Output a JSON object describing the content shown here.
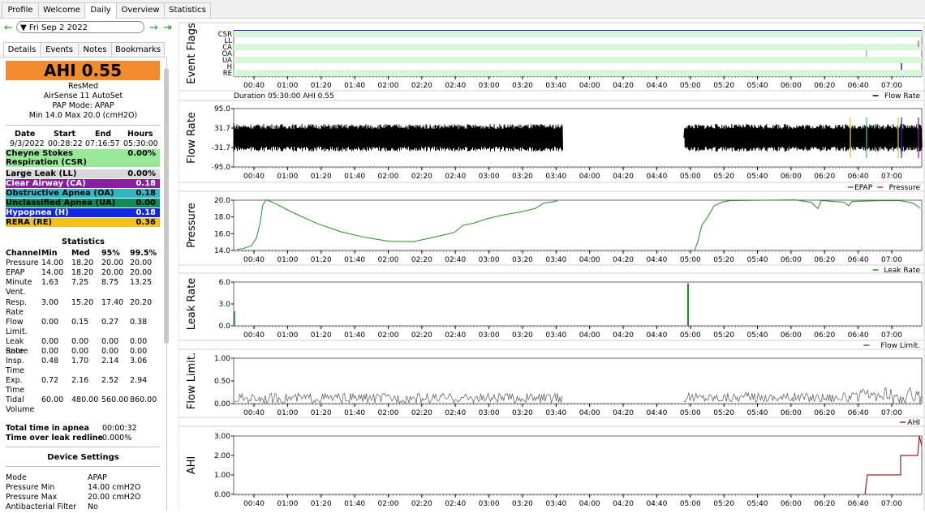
{
  "top_tabs": [
    "Profile",
    "Welcome",
    "Daily",
    "Overview",
    "Statistics"
  ],
  "date": "Fri Sep 2 2022",
  "sub_tabs": [
    "Details",
    "Events",
    "Notes",
    "Bookmarks"
  ],
  "ahi_label": "AHI 0.55",
  "device": {
    "brand": "ResMed",
    "model": "AirSense 11 AutoSet",
    "mode": "PAP Mode: APAP",
    "range": "Min 14.0 Max 20.0 (cmH2O)"
  },
  "session": {
    "headers": [
      "Date",
      "Start",
      "End",
      "Hours"
    ],
    "values": [
      "9/3/2022",
      "00:28:22",
      "07:16:57",
      "05:30:00"
    ]
  },
  "events": [
    {
      "name": "Cheyne Stokes Respiration (CSR)",
      "value": "0.00%",
      "color": "#98e898",
      "text": "#000"
    },
    {
      "name": "Large Leak (LL)",
      "value": "0.00%",
      "color": "#d8d8d8",
      "text": "#000"
    },
    {
      "name": "Clear Airway (CA)",
      "value": "0.18",
      "color": "#8a1fa0",
      "text": "#fff"
    },
    {
      "name": "Obstructive Apnea (OA)",
      "value": "0.18",
      "color": "#31b6c8",
      "text": "#000"
    },
    {
      "name": "Unclassified Apnea (UA)",
      "value": "0.00",
      "color": "#0e8a5f",
      "text": "#000"
    },
    {
      "name": "Hypopnea (H)",
      "value": "0.18",
      "color": "#1026e0",
      "text": "#fff"
    },
    {
      "name": "RERA (RE)",
      "value": "0.36",
      "color": "#f1c21a",
      "text": "#000"
    }
  ],
  "statistics": {
    "title": "Statistics",
    "headers": [
      "Channel",
      "Min",
      "Med",
      "95%",
      "99.5%"
    ],
    "rows": [
      [
        "Pressure",
        "14.00",
        "18.20",
        "20.00",
        "20.00"
      ],
      [
        "EPAP",
        "14.00",
        "18.20",
        "20.00",
        "20.00"
      ],
      [
        "Minute Vent.",
        "1.63",
        "7.25",
        "8.75",
        "13.25"
      ],
      [
        "Resp. Rate",
        "3.00",
        "15.20",
        "17.40",
        "20.20"
      ],
      [
        "Flow Limit.",
        "0.00",
        "0.15",
        "0.27",
        "0.38"
      ],
      [
        "Leak Rate",
        "0.00",
        "0.00",
        "0.00",
        "0.00"
      ],
      [
        "Snore",
        "0.00",
        "0.00",
        "0.00",
        "0.00"
      ],
      [
        "Insp. Time",
        "0.48",
        "1.70",
        "2.14",
        "3.06"
      ],
      [
        "Exp. Time",
        "0.72",
        "2.16",
        "2.52",
        "2.94"
      ],
      [
        "Tidal Volume",
        "60.00",
        "480.00",
        "560.00",
        "860.00"
      ]
    ]
  },
  "totals": [
    [
      "Total time in apnea",
      "00:00:32"
    ],
    [
      "Time over leak redline",
      "0.000%"
    ]
  ],
  "device_settings": {
    "title": "Device Settings",
    "rows": [
      [
        "Mode",
        "APAP"
      ],
      [
        "Pressure Min",
        "14.00 cmH2O"
      ],
      [
        "Pressure Max",
        "20.00 cmH2O"
      ],
      [
        "Antibacterial Filter",
        "No"
      ]
    ]
  },
  "time_ticks": [
    "00:40",
    "01:00",
    "01:20",
    "01:40",
    "02:00",
    "02:20",
    "02:40",
    "03:00",
    "03:20",
    "03:40",
    "04:00",
    "04:20",
    "04:40",
    "05:00",
    "05:20",
    "05:40",
    "06:00",
    "06:20",
    "06:40",
    "07:00"
  ],
  "charts": [
    {
      "id": "event-flags",
      "title": "Event Flags",
      "rows": [
        "CSR",
        "LL",
        "CA",
        "OA",
        "UA",
        "H",
        "RE"
      ]
    },
    {
      "id": "flow-rate",
      "title": "Flow Rate",
      "legend": [
        "Flow Rate"
      ],
      "info": "Duration 05:30:00 AHI 0.55",
      "y_ticks": [
        "95.0",
        "31.7",
        "-31.7",
        "-95.0"
      ]
    },
    {
      "id": "pressure",
      "title": "Pressure",
      "legend": [
        "EPAP",
        "Pressure"
      ],
      "y_ticks": [
        "20.0",
        "18.0",
        "16.0",
        "14.0"
      ]
    },
    {
      "id": "leak-rate",
      "title": "Leak Rate",
      "legend": [
        "Leak Rate"
      ],
      "y_ticks": [
        "6.0",
        "3.0",
        "0.0"
      ]
    },
    {
      "id": "flow-limit",
      "title": "Flow Limit.",
      "legend": [
        "Flow Limit."
      ],
      "y_ticks": [
        "1.00",
        "0.50",
        "0.00"
      ]
    },
    {
      "id": "ahi",
      "title": "AHI",
      "legend": [
        "AHI"
      ],
      "y_ticks": [
        "3.00",
        "2.00",
        "1.00",
        "0.00"
      ]
    }
  ],
  "colors": {
    "flow": "#000000",
    "epap": "#1f8f1f",
    "pressure": "#e02020",
    "leak": "#1f8f1f",
    "flowlimit": "#555555",
    "ahi": "#a02020",
    "flagbg": "#d8f5d8",
    "flagborder": "#2a2ad0"
  }
}
